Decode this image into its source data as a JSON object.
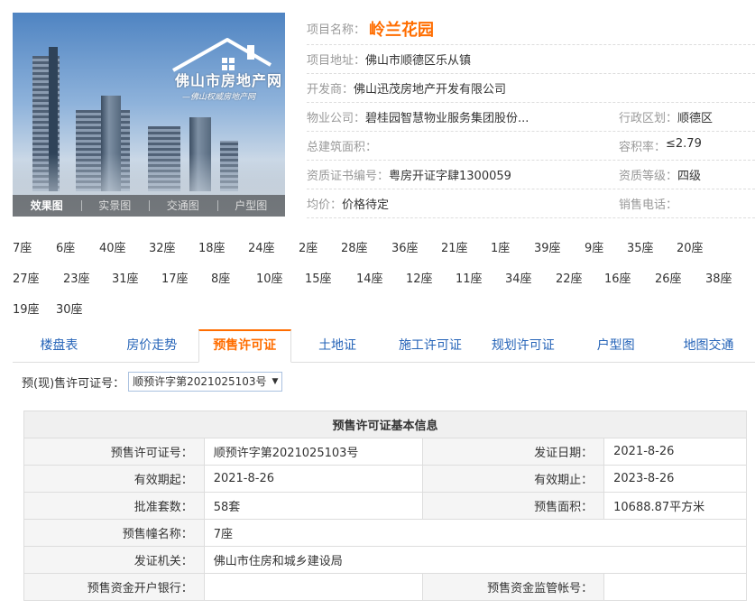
{
  "gallery": {
    "watermark_title": "佛山市房地产网",
    "watermark_sub": "—佛山权威房地产网",
    "tabs": [
      "效果图",
      "实景图",
      "交通图",
      "户型图"
    ]
  },
  "info": {
    "name_label": "项目名称：",
    "name": "岭兰花园",
    "address_label": "项目地址：",
    "address": "佛山市顺德区乐从镇",
    "developer_label": "开发商：",
    "developer": "佛山迅茂房地产开发有限公司",
    "property_label": "物业公司：",
    "property": "碧桂园智慧物业服务集团股份...",
    "district_label": "行政区划：",
    "district": "顺德区",
    "area_label": "总建筑面积：",
    "area": "",
    "far_label": "容积率：",
    "far": "≤2.79",
    "cert_label": "资质证书编号：",
    "cert": "粤房开证字肆1300059",
    "grade_label": "资质等级：",
    "grade": "四级",
    "price_label": "均价：",
    "price": "价格待定",
    "phone_label": "销售电话：",
    "phone": ""
  },
  "buildings": [
    [
      "7座",
      "6座",
      "40座",
      "32座",
      "18座",
      "24座",
      "2座",
      "28座",
      "36座",
      "21座",
      "1座",
      "39座",
      "9座",
      "35座",
      "20座"
    ],
    [
      "27座",
      "23座",
      "31座",
      "17座",
      "8座",
      "10座",
      "15座",
      "14座",
      "12座",
      "11座",
      "34座",
      "22座",
      "16座",
      "26座",
      "38座"
    ],
    [
      "19座",
      "30座"
    ]
  ],
  "tabs": [
    "楼盘表",
    "房价走势",
    "预售许可证",
    "土地证",
    "施工许可证",
    "规划许可证",
    "户型图",
    "地图交通"
  ],
  "permit_select": {
    "label": "预(现)售许可证号：",
    "value": "顺预许字第2021025103号"
  },
  "table": {
    "title": "预售许可证基本信息",
    "permit_no_label": "预售许可证号：",
    "permit_no": "顺预许字第2021025103号",
    "issue_date_label": "发证日期：",
    "issue_date": "2021-8-26",
    "valid_from_label": "有效期起：",
    "valid_from": "2021-8-26",
    "valid_to_label": "有效期止：",
    "valid_to": "2023-8-26",
    "units_label": "批准套数：",
    "units": "58套",
    "presale_area_label": "预售面积：",
    "presale_area": "10688.87平方米",
    "building_label": "预售幢名称：",
    "building": "7座",
    "authority_label": "发证机关：",
    "authority": "佛山市住房和城乡建设局",
    "bank_label": "预售资金开户银行：",
    "bank": "",
    "account_label": "预售资金监管帐号：",
    "account": ""
  }
}
